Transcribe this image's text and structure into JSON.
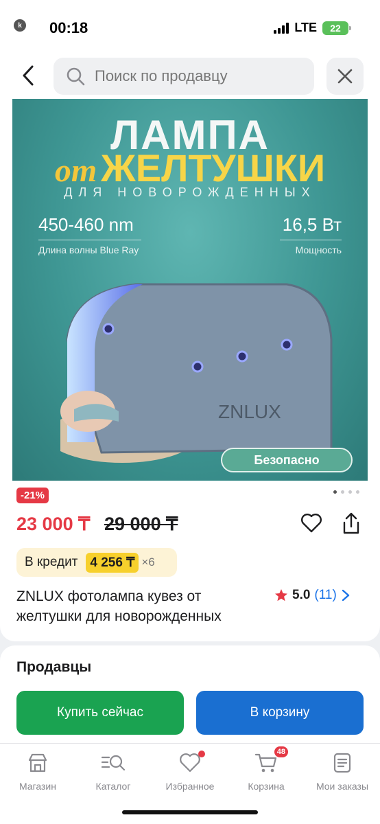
{
  "status_bar": {
    "back_app": "Kaspi.kz",
    "time": "00:18",
    "network": "LTE",
    "battery": "22"
  },
  "search": {
    "placeholder": "Поиск по продавцу",
    "icons": [
      "chevron-left-icon",
      "search-icon",
      "close-icon"
    ]
  },
  "banner": {
    "line1": "ЛАМПА",
    "line2_prefix": "от",
    "line2": "ЖЕЛТУШКИ",
    "line3": "ДЛЯ НОВОРОЖДЕННЫХ",
    "spec_left_value": "450-460 nm",
    "spec_left_label": "Длина волны Blue Ray",
    "spec_right_value": "16,5 Вт",
    "spec_right_label": "Мощность",
    "brand": "ZNLUX",
    "badge": "Безопасно",
    "colors": {
      "bg": "#3e9693",
      "accent": "#f7d548"
    }
  },
  "product": {
    "discount": "-21%",
    "carousel_total": 4,
    "carousel_active": 1,
    "price": "23 000 ₸",
    "old_price": "29 000 ₸",
    "credit_label": "В кредит",
    "credit_amount": "4 256 ₸",
    "credit_months": "×6",
    "title": "ZNLUX фотолампа кувез от желтушки для новорожденных",
    "rating": "5.0",
    "reviews": "(11)",
    "accent_color": "#e53945"
  },
  "sellers": {
    "heading": "Продавцы",
    "buy_now": "Купить сейчас",
    "add_to_cart": "В корзину",
    "buy_color": "#1aa351",
    "cart_color": "#1a6fd1"
  },
  "tabbar": {
    "items": [
      {
        "label": "Магазин",
        "icon": "shop-icon"
      },
      {
        "label": "Каталог",
        "icon": "catalog-search-icon"
      },
      {
        "label": "Избранное",
        "icon": "heart-icon"
      },
      {
        "label": "Корзина",
        "icon": "cart-icon",
        "badge": "48"
      },
      {
        "label": "Мои заказы",
        "icon": "orders-icon"
      }
    ]
  }
}
